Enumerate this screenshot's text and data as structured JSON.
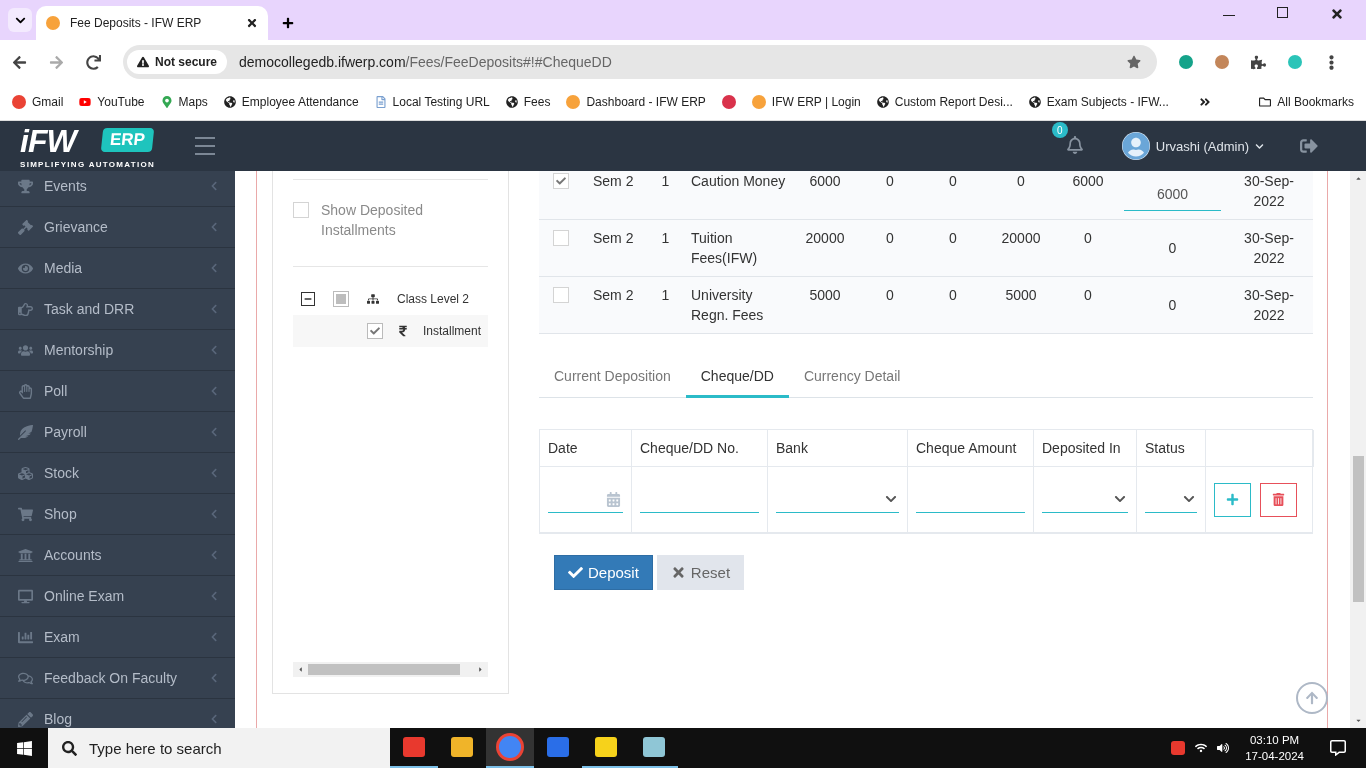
{
  "browser": {
    "tab_title": "Fee Deposits - IFW ERP",
    "security_label": "Not secure",
    "url_host": "democollegedb.ifwerp.com",
    "url_path": "/Fees/FeeDeposits#!#ChequeDD",
    "bookmarks": [
      "Gmail",
      "YouTube",
      "Maps",
      "Employee Attendance",
      "Local Testing URL",
      "Fees",
      "Dashboard - IFW ERP",
      "IFW ERP | Login",
      "Custom Report Desi...",
      "Exam Subjects - IFW..."
    ],
    "all_bookmarks": "All Bookmarks"
  },
  "logo": {
    "name": "iFW",
    "badge": "ERP",
    "tagline": "SIMPLIFYING AUTOMATION"
  },
  "header": {
    "notification_count": "0",
    "user_name": "Urvashi (Admin)"
  },
  "sidebar": {
    "items": [
      {
        "label": "Events"
      },
      {
        "label": "Grievance"
      },
      {
        "label": "Media"
      },
      {
        "label": "Task and DRR"
      },
      {
        "label": "Mentorship"
      },
      {
        "label": "Poll"
      },
      {
        "label": "Payroll"
      },
      {
        "label": "Stock"
      },
      {
        "label": "Shop"
      },
      {
        "label": "Accounts"
      },
      {
        "label": "Online Exam"
      },
      {
        "label": "Exam"
      },
      {
        "label": "Feedback On Faculty"
      },
      {
        "label": "Blog"
      }
    ]
  },
  "filter_panel": {
    "show_deposited": {
      "label": "Show Deposited Installments",
      "checked": false
    },
    "tree": [
      {
        "label": "Class Level 2",
        "expanded": true,
        "checked": false,
        "partial": true,
        "children": [
          {
            "label": "Installment",
            "checked": true
          }
        ]
      }
    ]
  },
  "fee_rows": [
    {
      "checked": true,
      "cells": [
        "Sem 2",
        "1",
        "Caution Money",
        "6000",
        "0",
        "0",
        "0",
        "6000"
      ],
      "amount": {
        "kind": "input",
        "value": "6000"
      },
      "date": "30-Sep-2022"
    },
    {
      "checked": false,
      "cells": [
        "Sem 2",
        "1",
        "Tuition Fees(IFW)",
        "20000",
        "0",
        "0",
        "20000",
        "0"
      ],
      "amount": {
        "kind": "text",
        "value": "0"
      },
      "date": "30-Sep-2022"
    },
    {
      "checked": false,
      "cells": [
        "Sem 2",
        "1",
        "University Regn. Fees",
        "5000",
        "0",
        "0",
        "5000",
        "0"
      ],
      "amount": {
        "kind": "text",
        "value": "0"
      },
      "date": "30-Sep-2022"
    }
  ],
  "tabs": [
    {
      "label": "Current Deposition",
      "selected": false
    },
    {
      "label": "Cheque/DD",
      "selected": true
    },
    {
      "label": "Currency Detail",
      "selected": false
    }
  ],
  "cheque_table": {
    "columns": [
      "Date",
      "Cheque/DD No.",
      "Bank",
      "Cheque Amount",
      "Deposited In",
      "Status"
    ],
    "fields": [
      {
        "kind": "date"
      },
      {
        "kind": "text"
      },
      {
        "kind": "select"
      },
      {
        "kind": "text"
      },
      {
        "kind": "select"
      },
      {
        "kind": "select"
      }
    ]
  },
  "buttons": {
    "deposit": "Deposit",
    "reset": "Reset"
  },
  "taskbar": {
    "search_placeholder": "Type here to search",
    "time": "03:10 PM",
    "date": "17-04-2024"
  }
}
